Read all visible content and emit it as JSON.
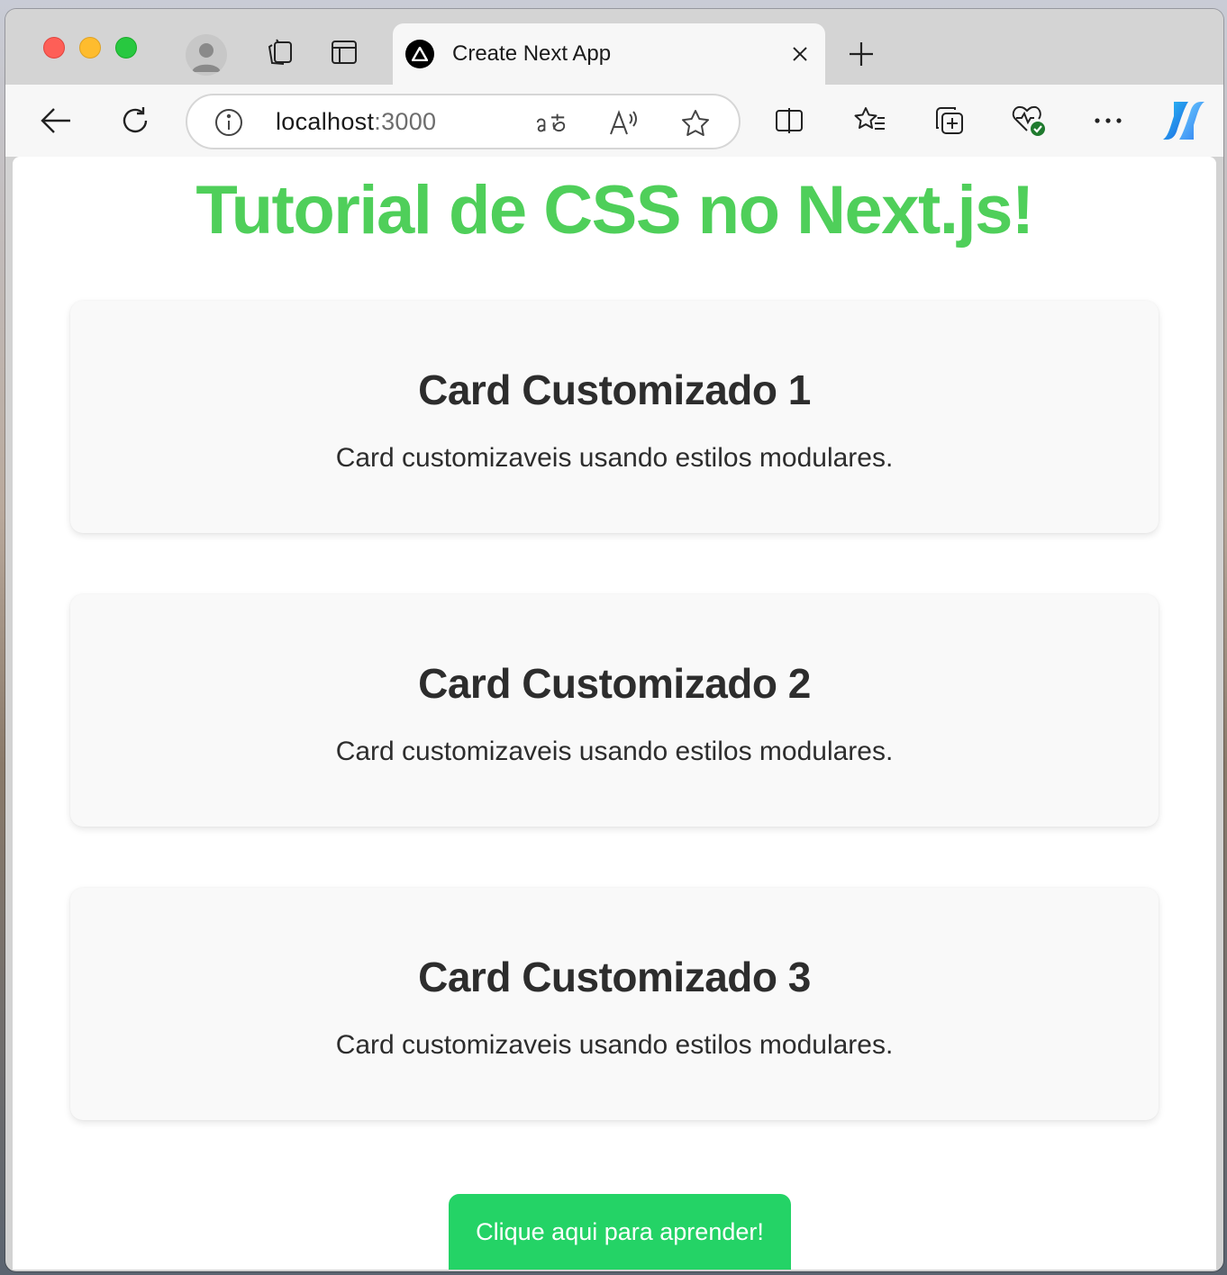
{
  "browser": {
    "tab": {
      "title": "Create Next App",
      "favicon": "nextjs-triangle-icon"
    },
    "address_bar": {
      "host": "localhost",
      "port": ":3000"
    },
    "icons": [
      "back-icon",
      "reload-icon",
      "info-icon",
      "translate-icon",
      "read-aloud-icon",
      "favorite-star-icon",
      "split-screen-icon",
      "favorites-icon",
      "collections-icon",
      "browser-essentials-icon",
      "more-icon",
      "copilot-icon",
      "profile-icon",
      "workspaces-icon",
      "vertical-tabs-icon",
      "close-tab-icon",
      "new-tab-icon"
    ]
  },
  "page": {
    "title": "Tutorial de CSS no Next.js!",
    "title_color": "#4fcf5a",
    "cards": [
      {
        "title": "Card Customizado 1",
        "text": "Card customizaveis usando estilos modulares."
      },
      {
        "title": "Card Customizado 2",
        "text": "Card customizaveis usando estilos modulares."
      },
      {
        "title": "Card Customizado 3",
        "text": "Card customizaveis usando estilos modulares."
      }
    ],
    "cta": {
      "label": "Clique aqui para aprender!",
      "color": "#24d366"
    }
  }
}
